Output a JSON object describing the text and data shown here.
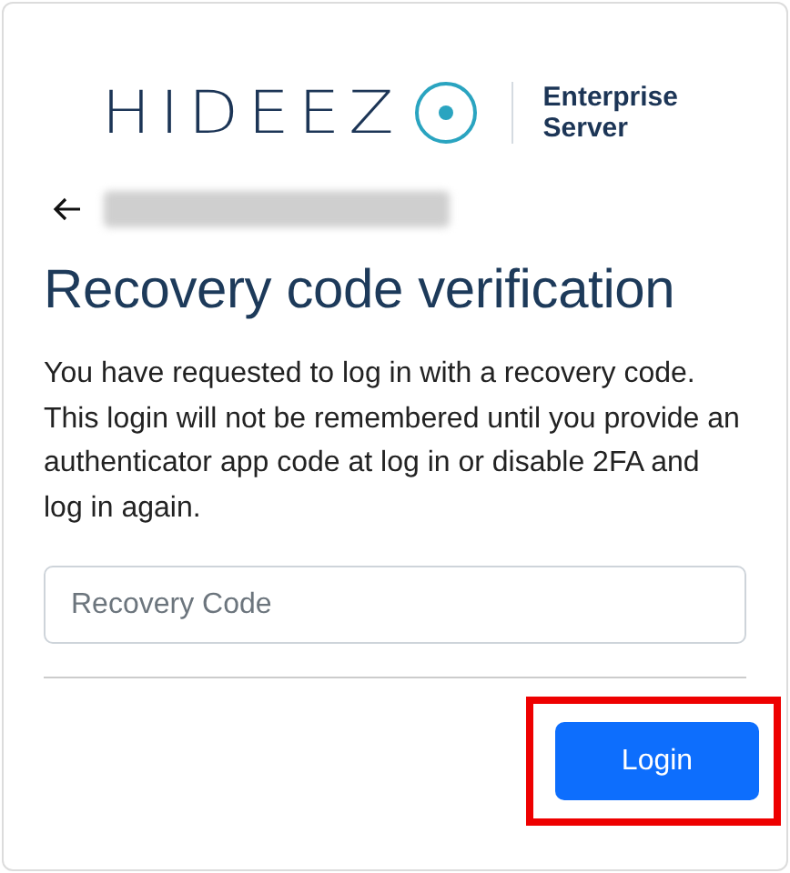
{
  "logo": {
    "wordmark": "HIDEEZ",
    "product": "Enterprise Server"
  },
  "heading": "Recovery code verification",
  "description": "You have requested to log in with a recovery code. This login will not be remembered until you provide an authenticator app code at log in or disable 2FA and log in again.",
  "recovery_field": {
    "placeholder": "Recovery Code"
  },
  "login_button": {
    "label": "Login",
    "highlighted": true
  }
}
